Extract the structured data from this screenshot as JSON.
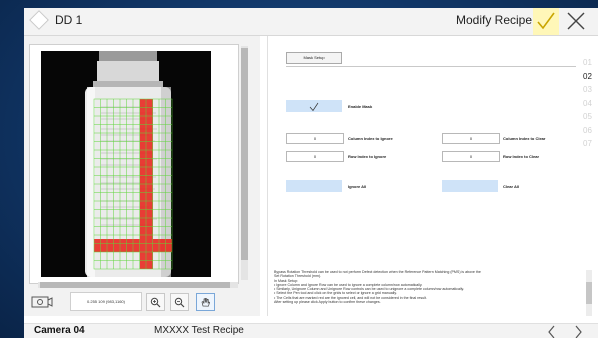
{
  "titlebar": {
    "title": "DD 1",
    "heading": "Modify Recipe",
    "confirm_icon": "check-icon",
    "close_icon": "close-icon"
  },
  "image_panel": {
    "coords_text": "0.255 109 (983,1160)",
    "tools": [
      "zoom-in-icon",
      "zoom-out-icon",
      "hand-pan-icon"
    ],
    "camera_icon": "camera-icon"
  },
  "mask_setup": {
    "tab_label": "Mask Setup",
    "enable_mask_label": "Enable Mask",
    "enable_mask_checked": true,
    "column_index_to_ignore": {
      "label": "Column Index to Ignore",
      "value": "0"
    },
    "column_index_to_clear": {
      "label": "Column Index to Clear",
      "value": "0"
    },
    "row_index_to_ignore": {
      "label": "Row Index to Ignore",
      "value": "0"
    },
    "row_index_to_clear": {
      "label": "Row Index to Clear",
      "value": "0"
    },
    "ignore_all_label": "Ignore All",
    "clear_all_label": "Clear All"
  },
  "pages": [
    "01",
    "02",
    "03",
    "04",
    "05",
    "06",
    "07"
  ],
  "active_page": "02",
  "info_lines": [
    "Bypass Rotation Threshold can be used to not perform Defect detection when the Reference Pattern Matching (PMS) is above the",
    "Set Rotation Threshold (mm).",
    "In Mask Setup:",
    "• Ignore Column and Ignore Row can be used to ignore a complete column/row automatically.",
    "• Similarly, Unignore Column and Unignore Row controls can be used to unignore a complete column/row automatically.",
    "• Select the Pen tool and click on the grids to select or ignore a grid manually.",
    "• The Cells that are marked red are the ignored cell, and will not be considered in the final result.",
    "After setting up please click Apply button to confirm these changes."
  ],
  "status": {
    "camera": "Camera 04",
    "recipe": "MXXXX Test Recipe",
    "prev_icon": "chevron-left-icon",
    "next_icon": "chevron-right-icon"
  },
  "colors": {
    "accent_blue": "#cfe3f8",
    "mask_red": "#e8241c",
    "grid_green": "#5fd43a",
    "confirm_yellow": "#fff7b8"
  }
}
